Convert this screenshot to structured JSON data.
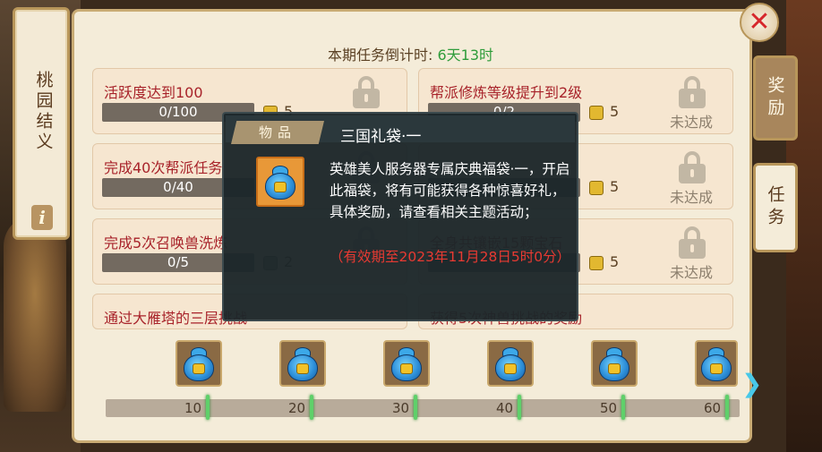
{
  "left_tab": {
    "label": "桃园结义",
    "info_glyph": "i"
  },
  "countdown": {
    "label": "本期任务倒计时: ",
    "value": "6天13时"
  },
  "tasks": [
    {
      "title": "活跃度达到100",
      "progress": "0/100",
      "reward_count": "5",
      "status": ""
    },
    {
      "title": "帮派修炼等级提升到2级",
      "progress": "0/2",
      "reward_count": "5",
      "status": "未达成"
    },
    {
      "title": "完成40次帮派任务",
      "progress": "0/40",
      "reward_count": "",
      "status": ""
    },
    {
      "title": "",
      "progress": "",
      "reward_count": "5",
      "status": "未达成"
    },
    {
      "title": "完成5次召唤兽洗炼",
      "progress": "0/5",
      "reward_count": "2",
      "status": ""
    },
    {
      "title": "全身共镶嵌15颗宝石",
      "progress": "",
      "reward_count": "5",
      "status": "未达成"
    },
    {
      "title": "通过大雁塔的三层挑战",
      "progress": "",
      "reward_count": "",
      "status": ""
    },
    {
      "title": "获得5次神兽挑战的奖励",
      "progress": "",
      "reward_count": "",
      "status": ""
    }
  ],
  "side_tabs": {
    "reward": "奖励",
    "task": "任务"
  },
  "close_glyph": "✕",
  "milestones": [
    "10",
    "20",
    "30",
    "40",
    "50",
    "60"
  ],
  "milestone_progress": 0,
  "next_glyph": "❯",
  "tooltip": {
    "category": "物品",
    "name": "三国礼袋·一",
    "description": "英雄美人服务器专属庆典福袋·一，开启此福袋，将有可能获得各种惊喜好礼，具体奖励，请查看相关主题活动；",
    "expiry": "（有效期至2023年11月28日5时0分）"
  },
  "colors": {
    "task_title": "#a8232a",
    "countdown_value": "#2e9c3a",
    "expiry": "#e83a32",
    "milestone_tick": "#5fd06a"
  },
  "icons": {
    "lock": "lock-icon",
    "reward": "ingot-icon",
    "gift": "gift-bag-icon",
    "close": "close-icon",
    "next": "chevron-right-icon"
  }
}
